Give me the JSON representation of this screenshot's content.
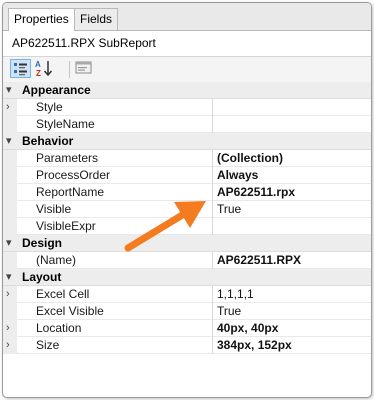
{
  "tabs": [
    {
      "label": "Properties",
      "active": true
    },
    {
      "label": "Fields",
      "active": false
    }
  ],
  "object_title": "AP622511.RPX SubReport",
  "toolbar": {
    "icons": [
      "categorized-icon",
      "alphabetical-sort-icon",
      "property-pages-icon"
    ]
  },
  "grid": {
    "categories": [
      {
        "label": "Appearance",
        "props": [
          {
            "name": "Style",
            "value": "",
            "expandable": true,
            "bold": false
          },
          {
            "name": "StyleName",
            "value": "",
            "expandable": false,
            "bold": false
          }
        ]
      },
      {
        "label": "Behavior",
        "props": [
          {
            "name": "Parameters",
            "value": "(Collection)",
            "expandable": false,
            "bold": true
          },
          {
            "name": "ProcessOrder",
            "value": "Always",
            "expandable": false,
            "bold": true
          },
          {
            "name": "ReportName",
            "value": "AP622511.rpx",
            "expandable": false,
            "bold": true
          },
          {
            "name": "Visible",
            "value": "True",
            "expandable": false,
            "bold": false
          },
          {
            "name": "VisibleExpr",
            "value": "",
            "expandable": false,
            "bold": false
          }
        ]
      },
      {
        "label": "Design",
        "props": [
          {
            "name": "(Name)",
            "value": "AP622511.RPX",
            "expandable": false,
            "bold": true
          }
        ]
      },
      {
        "label": "Layout",
        "props": [
          {
            "name": "Excel Cell",
            "value": "1,1,1,1",
            "expandable": true,
            "bold": false
          },
          {
            "name": "Excel Visible",
            "value": "True",
            "expandable": false,
            "bold": false
          },
          {
            "name": "Location",
            "value": "40px, 40px",
            "expandable": true,
            "bold": true
          },
          {
            "name": "Size",
            "value": "384px, 152px",
            "expandable": true,
            "bold": true
          }
        ]
      }
    ]
  },
  "annotation": {
    "color": "#f47b20",
    "icon": "arrow-icon"
  }
}
